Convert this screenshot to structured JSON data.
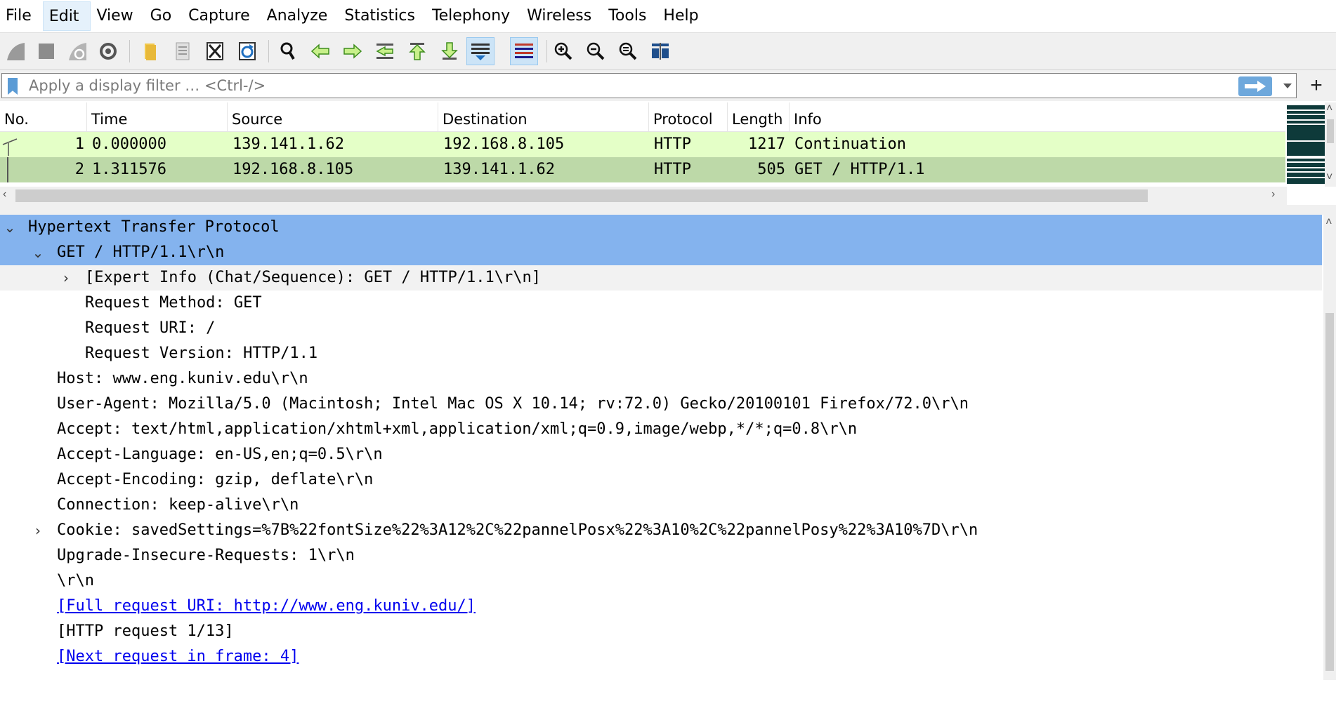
{
  "menu": {
    "items": [
      "File",
      "Edit",
      "View",
      "Go",
      "Capture",
      "Analyze",
      "Statistics",
      "Telephony",
      "Wireless",
      "Tools",
      "Help"
    ],
    "active": "Edit"
  },
  "toolbar": {
    "icons": [
      "start-capture-icon",
      "stop-capture-icon",
      "restart-capture-icon",
      "capture-options-icon",
      "open-file-icon",
      "save-file-icon",
      "close-file-icon",
      "reload-file-icon",
      "find-packet-icon",
      "go-back-icon",
      "go-forward-icon",
      "go-to-packet-icon",
      "go-first-packet-icon",
      "go-last-packet-icon",
      "auto-scroll-icon",
      "colorize-icon",
      "zoom-in-icon",
      "zoom-out-icon",
      "zoom-normal-icon",
      "resize-columns-icon"
    ]
  },
  "filter": {
    "placeholder": "Apply a display filter … <Ctrl-/>",
    "value": "",
    "add_label": "+"
  },
  "packet_list": {
    "columns": [
      "No.",
      "Time",
      "Source",
      "Destination",
      "Protocol",
      "Length",
      "Info"
    ],
    "rows": [
      {
        "no": "1",
        "time": "0.000000",
        "source": "139.141.1.62",
        "destination": "192.168.8.105",
        "protocol": "HTTP",
        "length": "1217",
        "info": "Continuation"
      },
      {
        "no": "2",
        "time": "1.311576",
        "source": "192.168.8.105",
        "destination": "139.141.1.62",
        "protocol": "HTTP",
        "length": "505",
        "info": "GET / HTTP/1.1"
      }
    ]
  },
  "detail": {
    "lines": [
      {
        "text": "Hypertext Transfer Protocol",
        "arrow": "expanded"
      },
      {
        "text": "GET / HTTP/1.1\\r\\n",
        "arrow": "expanded"
      },
      {
        "text": "[Expert Info (Chat/Sequence): GET / HTTP/1.1\\r\\n]",
        "arrow": "collapsed"
      },
      {
        "text": "Request Method: GET"
      },
      {
        "text": "Request URI: /"
      },
      {
        "text": "Request Version: HTTP/1.1"
      },
      {
        "text": "Host: www.eng.kuniv.edu\\r\\n"
      },
      {
        "text": "User-Agent: Mozilla/5.0 (Macintosh; Intel Mac OS X 10.14; rv:72.0) Gecko/20100101 Firefox/72.0\\r\\n"
      },
      {
        "text": "Accept: text/html,application/xhtml+xml,application/xml;q=0.9,image/webp,*/*;q=0.8\\r\\n"
      },
      {
        "text": "Accept-Language: en-US,en;q=0.5\\r\\n"
      },
      {
        "text": "Accept-Encoding: gzip, deflate\\r\\n"
      },
      {
        "text": "Connection: keep-alive\\r\\n"
      },
      {
        "text": "Cookie: savedSettings=%7B%22fontSize%22%3A12%2C%22pannelPosx%22%3A10%2C%22pannelPosy%22%3A10%7D\\r\\n",
        "arrow": "collapsed"
      },
      {
        "text": "Upgrade-Insecure-Requests: 1\\r\\n"
      },
      {
        "text": "\\r\\n"
      },
      {
        "text": "[Full request URI: http://www.eng.kuniv.edu/]",
        "link": true
      },
      {
        "text": "[HTTP request 1/13]"
      },
      {
        "text": "[Next request in frame: 4]",
        "link": true
      }
    ]
  },
  "colors": {
    "selected_row": "#84b3ee",
    "http_row_1": "#e4ffc7",
    "http_row_2": "#bdd9a8",
    "link": "#0000ee"
  }
}
